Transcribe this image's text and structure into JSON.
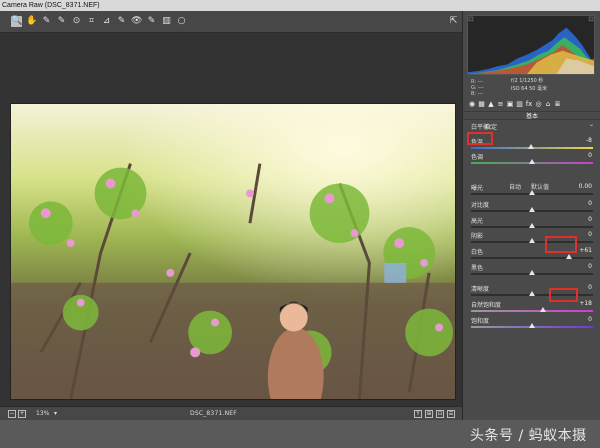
{
  "window": {
    "title": "Camera Raw (DSC_8371.NEF)"
  },
  "toolbar": {
    "tools": [
      {
        "name": "zoom-tool-icon",
        "glyph": "🔍"
      },
      {
        "name": "hand-tool-icon",
        "glyph": "✋"
      },
      {
        "name": "white-balance-tool-icon",
        "glyph": "✎"
      },
      {
        "name": "color-sampler-tool-icon",
        "glyph": "✎"
      },
      {
        "name": "targeted-adjustment-tool-icon",
        "glyph": "⊙"
      },
      {
        "name": "crop-tool-icon",
        "glyph": "⌗"
      },
      {
        "name": "straighten-tool-icon",
        "glyph": "⊿"
      },
      {
        "name": "spot-removal-tool-icon",
        "glyph": "✎"
      },
      {
        "name": "red-eye-tool-icon",
        "glyph": "👁"
      },
      {
        "name": "adjustment-brush-icon",
        "glyph": "✎"
      },
      {
        "name": "graduated-filter-icon",
        "glyph": "▥"
      },
      {
        "name": "radial-filter-icon",
        "glyph": "○"
      }
    ],
    "open_preferences_glyph": "⇱"
  },
  "status": {
    "zoom": "13%",
    "zoom_arrow": "▾",
    "filename": "DSC_8371.NEF",
    "minus": "−",
    "plus": "+",
    "view_y": "Y",
    "view_buttons": [
      "⊞",
      "⊡"
    ],
    "settings_glyph": "☰"
  },
  "info": {
    "rgb": [
      "R: ---",
      "G: ---",
      "B: ---"
    ],
    "exif_line1": "f/2  1/1250 秒",
    "exif_line2": "ISO 64  50 毫米"
  },
  "panel": {
    "tabs": [
      "◉",
      "▦",
      "▲",
      "≡",
      "▣",
      "▥",
      "fx",
      "◎",
      "⌂",
      "≣"
    ],
    "section_title": "基本",
    "wb_label": "白平衡：",
    "wb_value": "自定",
    "wb_chevron": "⌄",
    "auto_label": "自动",
    "default_label": "默认值",
    "sliders": [
      {
        "label": "色温",
        "value": "-8",
        "pos": 0.49,
        "group": "wb",
        "colors": [
          "#3d6bd1",
          "#e9d64a"
        ]
      },
      {
        "label": "色调",
        "value": "0",
        "pos": 0.5,
        "group": "wb",
        "colors": [
          "#3fb34a",
          "#c544c8"
        ]
      },
      {
        "label": "曝光",
        "value": "0.00",
        "pos": 0.5,
        "group": "tone"
      },
      {
        "label": "对比度",
        "value": "0",
        "pos": 0.5,
        "group": "tone"
      },
      {
        "label": "高光",
        "value": "0",
        "pos": 0.5,
        "group": "tone"
      },
      {
        "label": "阴影",
        "value": "0",
        "pos": 0.5,
        "group": "tone"
      },
      {
        "label": "白色",
        "value": "+61",
        "pos": 0.8,
        "group": "tone"
      },
      {
        "label": "黑色",
        "value": "0",
        "pos": 0.5,
        "group": "tone"
      },
      {
        "label": "清晰度",
        "value": "0",
        "pos": 0.5,
        "group": "pres"
      },
      {
        "label": "自然饱和度",
        "value": "+18",
        "pos": 0.59,
        "group": "pres",
        "colors": [
          "#9a9a9a",
          "#d23ad0"
        ]
      },
      {
        "label": "饱和度",
        "value": "0",
        "pos": 0.5,
        "group": "pres",
        "colors": [
          "#9a9a9a",
          "#6a3ad6"
        ]
      }
    ]
  },
  "watermark": "头条号 / 蚂蚁本摄",
  "colors": {
    "highlight_box": "#e0302a"
  }
}
